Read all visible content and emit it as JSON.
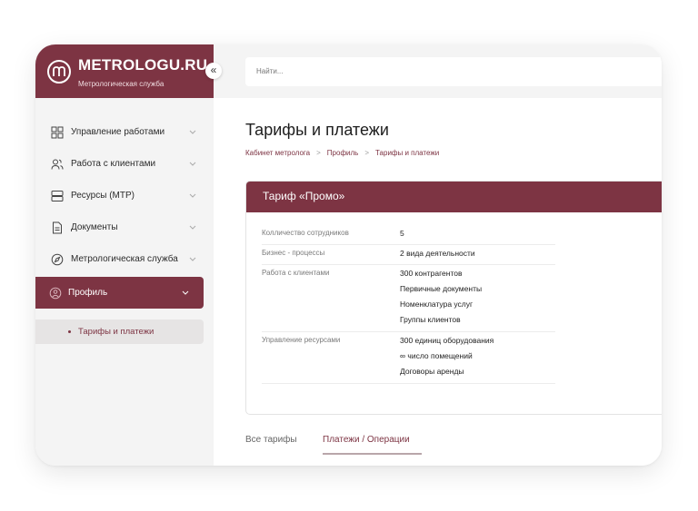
{
  "brand": {
    "name": "METROLOGU.RU",
    "subtitle": "Метрологическая служба",
    "collapse_icon": "«"
  },
  "search": {
    "placeholder": "Найти..."
  },
  "sidebar": {
    "items": [
      {
        "label": "Управление работами",
        "icon": "grid-icon"
      },
      {
        "label": "Работа с клиентами",
        "icon": "users-icon"
      },
      {
        "label": "Ресурсы (МТР)",
        "icon": "database-icon"
      },
      {
        "label": "Документы",
        "icon": "document-icon"
      },
      {
        "label": "Метрологическая служба",
        "icon": "compass-icon"
      },
      {
        "label": "Профиль",
        "icon": "user-circle-icon"
      }
    ],
    "submenu": {
      "label": "Тарифы и платежи"
    }
  },
  "page": {
    "title": "Тарифы и платежи",
    "breadcrumbs": [
      "Кабинет метролога",
      "Профиль",
      "Тарифы и платежи"
    ],
    "breadcrumb_sep": ">"
  },
  "tariff": {
    "title": "Тариф «Промо»",
    "rows": [
      {
        "label": "Колличество сотрудников",
        "values": [
          "5"
        ]
      },
      {
        "label": "Бизнес - процессы",
        "values": [
          "2 вида деятельности"
        ]
      },
      {
        "label": "Работа с клиентами",
        "values": [
          "300 контрагентов",
          "Первичные документы",
          "Номенклатура услуг",
          "Группы клиентов"
        ]
      },
      {
        "label": "Управление ресурсами",
        "values": [
          "300 единиц оборудования",
          "∞ число  помещений",
          "Договоры аренды"
        ]
      }
    ]
  },
  "tabs": {
    "all": "Все тарифы",
    "payments": "Платежи / Операции"
  },
  "colors": {
    "accent": "#7d3443",
    "sidebar_bg": "#f4f4f4"
  }
}
